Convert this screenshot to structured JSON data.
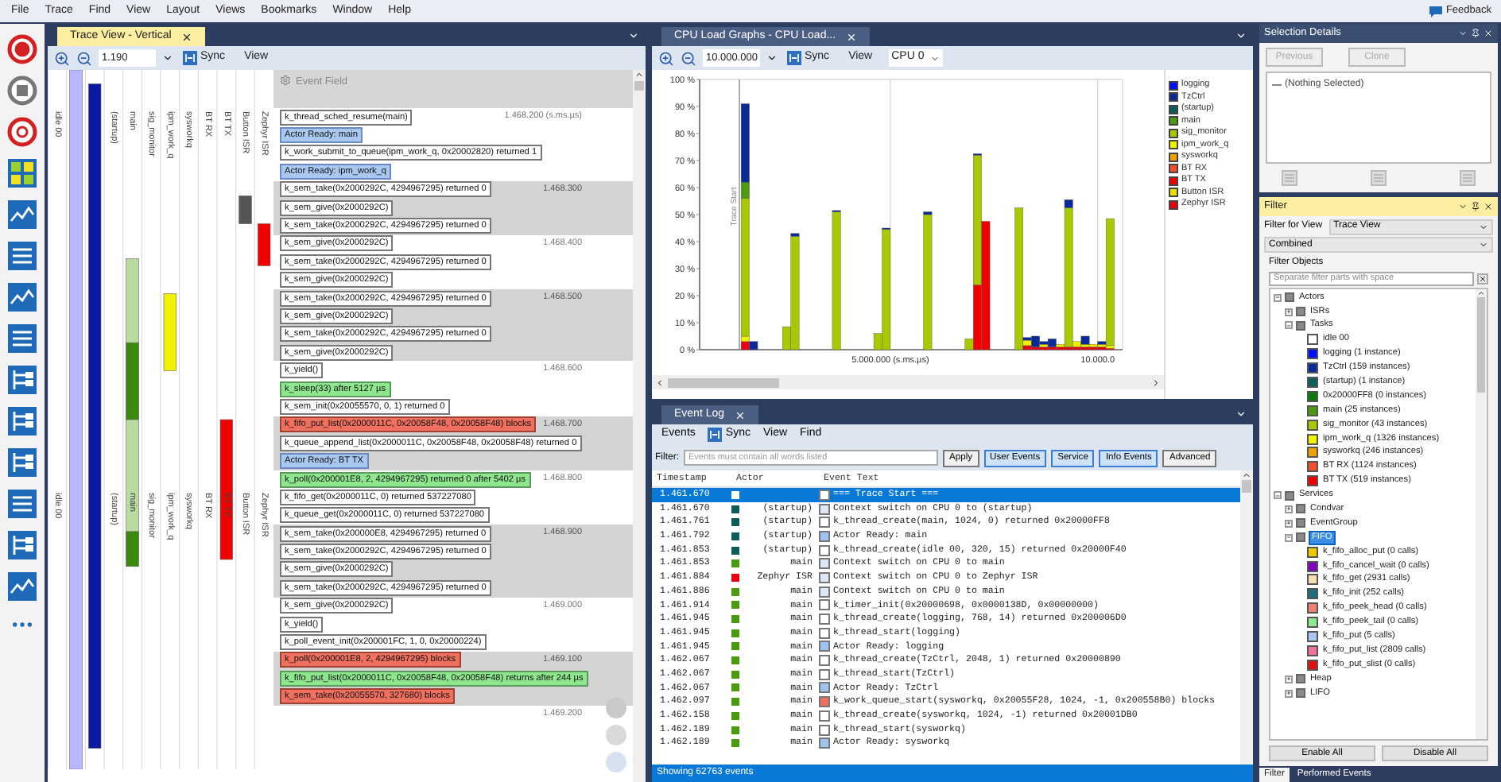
{
  "menu": {
    "items": [
      "File",
      "Trace",
      "Find",
      "View",
      "Layout",
      "Views",
      "Bookmarks",
      "Window",
      "Help"
    ],
    "feedback": "Feedback"
  },
  "trace_view": {
    "tab": {
      "label": "Trace View - Vertical",
      "selected": true
    },
    "zoom_value": "1.190",
    "sync": "Sync",
    "view": "View",
    "event_field": "Event Field",
    "lane_label_bands": [
      {
        "lanes": [
          {
            "kind": "label",
            "label": "idle 00"
          },
          {
            "kind": "covered"
          },
          {
            "kind": "covered"
          },
          {
            "kind": "label",
            "label": "(startup)"
          },
          {
            "kind": "label",
            "label": "main"
          },
          {
            "kind": "label",
            "label": "sig_monitor"
          },
          {
            "kind": "label",
            "label": "ipm_work_q"
          },
          {
            "kind": "label",
            "label": "sysworkq"
          },
          {
            "kind": "label",
            "label": "BT RX"
          },
          {
            "kind": "label",
            "label": "BT TX"
          },
          {
            "kind": "label",
            "label": "Button ISR"
          },
          {
            "kind": "label",
            "label": "Zephyr ISR"
          }
        ]
      },
      {
        "lanes": [
          {
            "kind": "label",
            "label": "idle 00"
          },
          {
            "kind": "covered"
          },
          {
            "kind": "covered"
          },
          {
            "kind": "label",
            "label": "(startup)"
          },
          {
            "kind": "label",
            "label": "main"
          },
          {
            "kind": "label",
            "label": "sig_monitor"
          },
          {
            "kind": "label",
            "label": "ipm_work_q"
          },
          {
            "kind": "label",
            "label": "sysworkq"
          },
          {
            "kind": "label",
            "label": "BT RX"
          },
          {
            "kind": "label",
            "label": "BT TX"
          },
          {
            "kind": "label",
            "label": "Button ISR"
          },
          {
            "kind": "label",
            "label": "Zephyr ISR"
          }
        ]
      }
    ],
    "segments": [
      {
        "time": "1.468.200 (s.ms.µs)",
        "events": [
          {
            "text": "k_thread_sched_resume(main)",
            "kind": "call"
          },
          {
            "text": "Actor Ready: main",
            "kind": "ready"
          },
          {
            "text": "k_work_submit_to_queue(ipm_work_q, 0x20002820) returned 1",
            "kind": "call"
          },
          {
            "text": "Actor Ready: ipm_work_q",
            "kind": "ready"
          }
        ]
      },
      {
        "time": "1.468.300",
        "events": [
          {
            "text": "k_sem_take(0x2000292C, 4294967295) returned 0",
            "kind": "call"
          },
          {
            "text": "k_sem_give(0x2000292C)",
            "kind": "call"
          },
          {
            "text": "k_sem_take(0x2000292C, 4294967295) returned 0",
            "kind": "call"
          }
        ]
      },
      {
        "time": "1.468.400",
        "events": [
          {
            "text": "k_sem_give(0x2000292C)",
            "kind": "call"
          },
          {
            "text": "k_sem_take(0x2000292C, 4294967295) returned 0",
            "kind": "call"
          },
          {
            "text": "k_sem_give(0x2000292C)",
            "kind": "call"
          }
        ]
      },
      {
        "time": "1.468.500",
        "events": [
          {
            "text": "k_sem_take(0x2000292C, 4294967295) returned 0",
            "kind": "call"
          },
          {
            "text": "k_sem_give(0x2000292C)",
            "kind": "call"
          },
          {
            "text": "k_sem_take(0x2000292C, 4294967295) returned 0",
            "kind": "call"
          },
          {
            "text": "k_sem_give(0x2000292C)",
            "kind": "call"
          }
        ]
      },
      {
        "time": "1.468.600",
        "events": [
          {
            "text": "k_yield()",
            "kind": "call"
          },
          {
            "text": "k_sleep(33) after 5127 µs",
            "kind": "ok"
          },
          {
            "text": "k_sem_init(0x20055570, 0, 1) returned 0",
            "kind": "call"
          }
        ]
      },
      {
        "time": "1.468.700",
        "events": [
          {
            "text": "k_fifo_put_list(0x2000011C, 0x20058F48, 0x20058F48) blocks",
            "kind": "block"
          },
          {
            "text": "k_queue_append_list(0x2000011C, 0x20058F48, 0x20058F48) returned 0",
            "kind": "call"
          },
          {
            "text": "Actor Ready: BT TX",
            "kind": "ready"
          }
        ]
      },
      {
        "time": "1.468.800",
        "events": [
          {
            "text": "k_poll(0x200001E8, 2, 4294967295) returned 0 after 5402 µs",
            "kind": "ok"
          },
          {
            "text": "k_fifo_get(0x2000011C, 0) returned 537227080",
            "kind": "call"
          },
          {
            "text": "k_queue_get(0x2000011C, 0) returned 537227080",
            "kind": "call"
          }
        ]
      },
      {
        "time": "1.468.900",
        "events": [
          {
            "text": "k_sem_take(0x200000E8, 4294967295) returned 0",
            "kind": "call"
          },
          {
            "text": "k_sem_take(0x2000292C, 4294967295) returned 0",
            "kind": "call"
          },
          {
            "text": "k_sem_give(0x2000292C)",
            "kind": "call"
          },
          {
            "text": "k_sem_take(0x2000292C, 4294967295) returned 0",
            "kind": "call"
          }
        ]
      },
      {
        "time": "1.469.000",
        "events": [
          {
            "text": "k_sem_give(0x2000292C)",
            "kind": "call"
          },
          {
            "text": "k_yield()",
            "kind": "call"
          },
          {
            "text": "k_poll_event_init(0x200001FC, 1, 0, 0x20000224)",
            "kind": "call"
          }
        ]
      },
      {
        "time": "1.469.100",
        "events": [
          {
            "text": "k_poll(0x200001E8, 2, 4294967295) blocks",
            "kind": "block"
          },
          {
            "text": "k_fifo_put_list(0x2000011C, 0x20058F48, 0x20058F48) returns after 244 µs",
            "kind": "ok"
          },
          {
            "text": "k_sem_take(0x20055570, 327680) blocks",
            "kind": "block"
          }
        ]
      },
      {
        "time": "1.469.200"
      }
    ]
  },
  "cpu_load": {
    "tab": {
      "label": "CPU Load Graphs - CPU Load...",
      "selected": false
    },
    "zoom_value": "10.000.000",
    "sync": "Sync",
    "view": "View",
    "cpu": "CPU 0",
    "time_axis_labels": [
      "5.000.000 (s.ms.µs)",
      "10.000.0"
    ],
    "trace_start_label": "Trace Start",
    "chart_data": {
      "type": "bar",
      "stacked": true,
      "orientation": "vertical",
      "categories": [
        null,
        null,
        null,
        null,
        null,
        null,
        null,
        null,
        null,
        null,
        null,
        null,
        null,
        null,
        null,
        null,
        null,
        null,
        null,
        null,
        null,
        null,
        null,
        null,
        null,
        null,
        null,
        null,
        null,
        null,
        null,
        null,
        null,
        null,
        null,
        null,
        null,
        null,
        null,
        null,
        null,
        null,
        null,
        null,
        null,
        null,
        null,
        null,
        null,
        null,
        null
      ],
      "ylim": [
        0,
        100
      ],
      "yticks": [
        {
          "value": 0,
          "label": "0 %"
        },
        {
          "value": 10,
          "label": "10 %"
        },
        {
          "value": 20,
          "label": "20 %"
        },
        {
          "value": 30,
          "label": "30 %"
        },
        {
          "value": 40,
          "label": "40 %"
        },
        {
          "value": 50,
          "label": "50 %"
        },
        {
          "value": 60,
          "label": "60 %"
        },
        {
          "value": 70,
          "label": "70 %"
        },
        {
          "value": 80,
          "label": "80 %"
        },
        {
          "value": 90,
          "label": "90 %"
        },
        {
          "value": 100,
          "label": "100 %"
        }
      ],
      "series": [
        {
          "name": "Zephyr ISR",
          "color": "#e80010",
          "values": [
            null,
            null,
            null,
            null,
            null,
            3,
            0,
            null,
            null,
            null,
            0,
            0,
            null,
            null,
            null,
            null,
            0,
            null,
            null,
            null,
            null,
            0,
            0,
            null,
            null,
            null,
            null,
            0,
            null,
            null,
            null,
            null,
            0,
            0,
            0,
            null,
            null,
            null,
            0,
            1.5,
            1,
            1,
            1,
            1,
            1,
            1,
            1,
            1,
            1,
            0.5,
            null
          ]
        },
        {
          "name": "Button ISR",
          "color": "#e8e000",
          "values": [
            null,
            null,
            null,
            null,
            null,
            null,
            null,
            null,
            null,
            null,
            null,
            null,
            null,
            null,
            null,
            null,
            null,
            null,
            null,
            null,
            null,
            null,
            null,
            null,
            null,
            null,
            null,
            null,
            null,
            null,
            null,
            null,
            null,
            null,
            null,
            null,
            null,
            null,
            null,
            null,
            null,
            null,
            null,
            null,
            null,
            null,
            null,
            null,
            null,
            null,
            null
          ]
        },
        {
          "name": "BT TX",
          "color": "#f00000",
          "values": [
            null,
            null,
            null,
            null,
            null,
            0,
            0,
            null,
            null,
            null,
            0,
            0,
            null,
            null,
            null,
            null,
            0,
            null,
            null,
            null,
            null,
            0,
            0,
            null,
            null,
            null,
            null,
            0,
            null,
            null,
            null,
            null,
            0,
            24,
            47.5,
            null,
            null,
            null,
            0,
            0,
            0,
            0,
            0,
            0,
            0,
            0,
            0,
            0,
            0,
            0,
            null
          ]
        },
        {
          "name": "BT RX",
          "color": "#f05030",
          "values": [
            null,
            null,
            null,
            null,
            null,
            null,
            null,
            null,
            null,
            null,
            null,
            null,
            null,
            null,
            null,
            null,
            null,
            null,
            null,
            null,
            null,
            null,
            null,
            null,
            null,
            null,
            null,
            null,
            null,
            null,
            null,
            null,
            null,
            null,
            null,
            null,
            null,
            null,
            null,
            null,
            null,
            null,
            null,
            null,
            null,
            null,
            null,
            null,
            null,
            null,
            null
          ]
        },
        {
          "name": "sysworkq",
          "color": "#f0a000",
          "values": [
            null,
            null,
            null,
            null,
            null,
            null,
            null,
            null,
            null,
            null,
            null,
            null,
            null,
            null,
            null,
            null,
            null,
            null,
            null,
            null,
            null,
            null,
            null,
            null,
            null,
            null,
            null,
            null,
            null,
            null,
            null,
            null,
            null,
            null,
            null,
            null,
            null,
            null,
            null,
            null,
            null,
            null,
            null,
            null,
            null,
            null,
            null,
            null,
            null,
            null,
            null
          ]
        },
        {
          "name": "ipm_work_q",
          "color": "#f0f000",
          "values": [
            null,
            null,
            null,
            null,
            null,
            2,
            0,
            null,
            null,
            null,
            0,
            0,
            null,
            null,
            null,
            null,
            0,
            null,
            null,
            null,
            null,
            0,
            0,
            null,
            null,
            null,
            null,
            0,
            null,
            null,
            null,
            null,
            0,
            0,
            0,
            null,
            null,
            null,
            0,
            2,
            0,
            1,
            0,
            1,
            0,
            2,
            1,
            1,
            1,
            1,
            null
          ]
        },
        {
          "name": "sig_monitor",
          "color": "#a8c800",
          "values": [
            null,
            null,
            null,
            null,
            null,
            51,
            0,
            null,
            null,
            null,
            8.5,
            42,
            null,
            null,
            null,
            null,
            51,
            null,
            null,
            null,
            null,
            6,
            44.5,
            null,
            null,
            null,
            null,
            50,
            null,
            null,
            null,
            null,
            4,
            48,
            0,
            null,
            null,
            null,
            52.5,
            0,
            0,
            0,
            0,
            0,
            51.5,
            0,
            0,
            0,
            0,
            47,
            null
          ]
        },
        {
          "name": "main",
          "color": "#4c9a10",
          "values": [
            null,
            null,
            null,
            null,
            null,
            6,
            0,
            null,
            null,
            null,
            0,
            0,
            null,
            null,
            null,
            null,
            0,
            null,
            null,
            null,
            null,
            0,
            0,
            null,
            null,
            null,
            null,
            0,
            null,
            null,
            null,
            null,
            0,
            0,
            0,
            null,
            null,
            null,
            0,
            0,
            0,
            0,
            0,
            0,
            0,
            0,
            0,
            0,
            0,
            0,
            null
          ]
        },
        {
          "name": "(startup)",
          "color": "#0f5c5c",
          "values": [
            null,
            null,
            null,
            null,
            null,
            null,
            null,
            null,
            null,
            null,
            null,
            null,
            null,
            null,
            null,
            null,
            null,
            null,
            null,
            null,
            null,
            null,
            null,
            null,
            null,
            null,
            null,
            null,
            null,
            null,
            null,
            null,
            null,
            null,
            null,
            null,
            null,
            null,
            null,
            null,
            null,
            null,
            null,
            null,
            null,
            null,
            null,
            null,
            null,
            null,
            null
          ]
        },
        {
          "name": "TzCtrl",
          "color": "#0a2a9a",
          "values": [
            null,
            null,
            null,
            null,
            null,
            29,
            3,
            null,
            null,
            null,
            0,
            1,
            null,
            null,
            null,
            null,
            0.5,
            null,
            null,
            null,
            null,
            0,
            0.5,
            null,
            null,
            null,
            null,
            1,
            null,
            null,
            null,
            null,
            0,
            0.5,
            0,
            null,
            null,
            null,
            0,
            1,
            4,
            1,
            3,
            0,
            3,
            0,
            3,
            0,
            1,
            0,
            null
          ]
        },
        {
          "name": "logging",
          "color": "#0010ff",
          "values": [
            null,
            null,
            null,
            null,
            null,
            null,
            null,
            null,
            null,
            null,
            null,
            null,
            null,
            null,
            null,
            null,
            null,
            null,
            null,
            null,
            null,
            null,
            null,
            null,
            null,
            null,
            null,
            null,
            null,
            null,
            null,
            null,
            null,
            null,
            null,
            null,
            null,
            null,
            null,
            null,
            null,
            null,
            null,
            null,
            null,
            null,
            null,
            null,
            null,
            null,
            null
          ]
        }
      ]
    }
  },
  "event_log": {
    "tab": {
      "label": "Event Log",
      "selected": false
    },
    "toolbar": [
      "Events",
      "Sync",
      "View",
      "Find"
    ],
    "filter_label": "Filter:",
    "filter_placeholder": "Events must contain all words listed",
    "buttons": [
      {
        "label": "Apply",
        "on": false
      },
      {
        "label": "User Events",
        "on": true
      },
      {
        "label": "Service",
        "on": true
      },
      {
        "label": "Info Events",
        "on": true
      },
      {
        "label": "Advanced",
        "on": false
      }
    ],
    "columns": [
      "Timestamp",
      "Actor",
      "Event Text"
    ],
    "rows": [
      {
        "ts": "1.461.670",
        "actor": {
          "color": "#ffffff"
        },
        "event": {
          "color": "#ffffff",
          "text": "=== Trace Start ==="
        },
        "selected": true
      },
      {
        "ts": "1.461.670",
        "actor": {
          "name": "(startup)",
          "color": "#0f5c5c"
        },
        "event": {
          "color": "#dce8f5",
          "text": "Context switch on CPU 0 to (startup)"
        },
        "selected": false
      },
      {
        "ts": "1.461.761",
        "actor": {
          "name": "(startup)",
          "color": "#0f5c5c"
        },
        "event": {
          "color": "#ffffff",
          "text": "k_thread_create(main, 1024, 0) returned 0x20000FF8"
        },
        "selected": false
      },
      {
        "ts": "1.461.792",
        "actor": {
          "name": "(startup)",
          "color": "#0f5c5c"
        },
        "event": {
          "color": "#9ec3ef",
          "text": "Actor Ready: main"
        },
        "selected": false
      },
      {
        "ts": "1.461.853",
        "actor": {
          "name": "(startup)",
          "color": "#0f5c5c"
        },
        "event": {
          "color": "#ffffff",
          "text": "k_thread_create(idle 00, 320, 15) returned 0x20000F40"
        },
        "selected": false
      },
      {
        "ts": "1.461.853",
        "actor": {
          "name": "main",
          "color": "#4c9a10"
        },
        "event": {
          "color": "#dce8f5",
          "text": "Context switch on CPU 0 to main"
        },
        "selected": false
      },
      {
        "ts": "1.461.884",
        "actor": {
          "name": "Zephyr ISR",
          "color": "#e80010"
        },
        "event": {
          "color": "#dce8f5",
          "text": "Context switch on CPU 0 to Zephyr ISR"
        },
        "selected": false
      },
      {
        "ts": "1.461.886",
        "actor": {
          "name": "main",
          "color": "#4c9a10"
        },
        "event": {
          "color": "#dce8f5",
          "text": "Context switch on CPU 0 to main"
        },
        "selected": false
      },
      {
        "ts": "1.461.914",
        "actor": {
          "name": "main",
          "color": "#4c9a10"
        },
        "event": {
          "color": "#ffffff",
          "text": "k_timer_init(0x20000698, 0x0000138D, 0x00000000)"
        },
        "selected": false
      },
      {
        "ts": "1.461.945",
        "actor": {
          "name": "main",
          "color": "#4c9a10"
        },
        "event": {
          "color": "#ffffff",
          "text": "k_thread_create(logging, 768, 14) returned 0x200006D0"
        },
        "selected": false
      },
      {
        "ts": "1.461.945",
        "actor": {
          "name": "main",
          "color": "#4c9a10"
        },
        "event": {
          "color": "#ffffff",
          "text": "k_thread_start(logging)"
        },
        "selected": false
      },
      {
        "ts": "1.461.945",
        "actor": {
          "name": "main",
          "color": "#4c9a10"
        },
        "event": {
          "color": "#9ec3ef",
          "text": "Actor Ready: logging"
        },
        "selected": false
      },
      {
        "ts": "1.462.067",
        "actor": {
          "name": "main",
          "color": "#4c9a10"
        },
        "event": {
          "color": "#ffffff",
          "text": "k_thread_create(TzCtrl, 2048, 1) returned 0x20000890"
        },
        "selected": false
      },
      {
        "ts": "1.462.067",
        "actor": {
          "name": "main",
          "color": "#4c9a10"
        },
        "event": {
          "color": "#ffffff",
          "text": "k_thread_start(TzCtrl)"
        },
        "selected": false
      },
      {
        "ts": "1.462.067",
        "actor": {
          "name": "main",
          "color": "#4c9a10"
        },
        "event": {
          "color": "#9ec3ef",
          "text": "Actor Ready: TzCtrl"
        },
        "selected": false
      },
      {
        "ts": "1.462.097",
        "actor": {
          "name": "main",
          "color": "#4c9a10"
        },
        "event": {
          "color": "#f07060",
          "text": "k_work_queue_start(sysworkq, 0x20055F28, 1024, -1, 0x200558B0) blocks"
        },
        "selected": false
      },
      {
        "ts": "1.462.158",
        "actor": {
          "name": "main",
          "color": "#4c9a10"
        },
        "event": {
          "color": "#ffffff",
          "text": "k_thread_create(sysworkq, 1024, -1) returned 0x20001DB0"
        },
        "selected": false
      },
      {
        "ts": "1.462.189",
        "actor": {
          "name": "main",
          "color": "#4c9a10"
        },
        "event": {
          "color": "#ffffff",
          "text": "k_thread_start(sysworkq)"
        },
        "selected": false
      },
      {
        "ts": "1.462.189",
        "actor": {
          "name": "main",
          "color": "#4c9a10"
        },
        "event": {
          "color": "#9ec3ef",
          "text": "Actor Ready: sysworkq"
        },
        "selected": false
      }
    ],
    "status": "Showing 62763 events"
  },
  "selection_details": {
    "title": "Selection Details",
    "buttons": [
      {
        "label": "Previous",
        "disabled": true
      },
      {
        "label": "Clone",
        "disabled": true
      }
    ],
    "tree_text": "(Nothing Selected)"
  },
  "filter": {
    "title": "Filter",
    "filter_for_view_label": "Filter for View",
    "filter_for_view": "Trace View",
    "mode": "Combined",
    "objects_label": "Filter Objects",
    "search_placeholder": "Separate filter parts with space",
    "tree": [
      {
        "label": "Actors",
        "expanded": true,
        "selected": false,
        "children": [
          {
            "label": "ISRs",
            "expanded": false,
            "selected": false
          },
          {
            "label": "Tasks",
            "expanded": true,
            "selected": false,
            "children": [
              {
                "label": "idle 00",
                "color": "#ffffff",
                "selected": false
              },
              {
                "label": "logging (1 instance)",
                "color": "#0010ff",
                "selected": false
              },
              {
                "label": "TzCtrl (159 instances)",
                "color": "#0a2a9a",
                "selected": false
              },
              {
                "label": "(startup) (1 instance)",
                "color": "#0f5c5c",
                "selected": false
              },
              {
                "label": "0x20000FF8 (0 instances)",
                "color": "#0a7a0a",
                "selected": false
              },
              {
                "label": "main (25 instances)",
                "color": "#4c9a10",
                "selected": false
              },
              {
                "label": "sig_monitor (43 instances)",
                "color": "#a8c800",
                "selected": false
              },
              {
                "label": "ipm_work_q (1326 instances)",
                "color": "#f0f000",
                "selected": false
              },
              {
                "label": "sysworkq (246 instances)",
                "color": "#f0a000",
                "selected": false
              },
              {
                "label": "BT RX (1124 instances)",
                "color": "#f05030",
                "selected": false
              },
              {
                "label": "BT TX (519 instances)",
                "color": "#f00000",
                "selected": false
              }
            ]
          }
        ]
      },
      {
        "label": "Services",
        "expanded": true,
        "selected": false,
        "children": [
          {
            "label": "Condvar",
            "expanded": false,
            "selected": false
          },
          {
            "label": "EventGroup",
            "expanded": false,
            "selected": false
          },
          {
            "label": "FIFO",
            "expanded": true,
            "selected": true,
            "children": [
              {
                "label": "k_fifo_alloc_put (0 calls)",
                "color": "#f0c800",
                "selected": false
              },
              {
                "label": "k_fifo_cancel_wait (0 calls)",
                "color": "#8000c0",
                "selected": false
              },
              {
                "label": "k_fifo_get (2931 calls)",
                "color": "#f5deb0",
                "selected": false
              },
              {
                "label": "k_fifo_init (252 calls)",
                "color": "#1e6e80",
                "selected": false
              },
              {
                "label": "k_fifo_peek_head (0 calls)",
                "color": "#f08070",
                "selected": false
              },
              {
                "label": "k_fifo_peek_tail (0 calls)",
                "color": "#90e890",
                "selected": false
              },
              {
                "label": "k_fifo_put (5 calls)",
                "color": "#a8c8f0",
                "selected": false
              },
              {
                "label": "k_fifo_put_list (2809 calls)",
                "color": "#f070a0",
                "selected": false
              },
              {
                "label": "k_fifo_put_slist (0 calls)",
                "color": "#e01010",
                "selected": false
              }
            ]
          },
          {
            "label": "Heap",
            "expanded": false,
            "selected": false
          },
          {
            "label": "LIFO",
            "expanded": false,
            "selected": false
          }
        ]
      }
    ],
    "buttons": [
      "Enable All",
      "Disable All"
    ],
    "bottom_tabs": [
      {
        "label": "Filter",
        "selected": true
      },
      {
        "label": "Performed Events",
        "selected": false
      }
    ]
  }
}
